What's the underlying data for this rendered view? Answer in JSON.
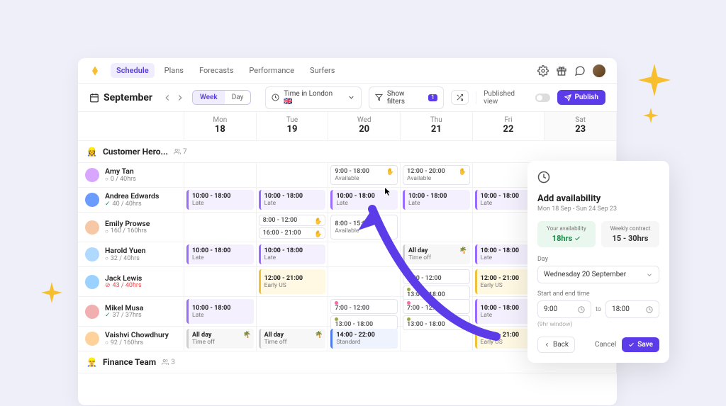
{
  "nav": {
    "tabs": [
      "Schedule",
      "Plans",
      "Forecasts",
      "Performance",
      "Surfers"
    ],
    "active": 0
  },
  "toolbar": {
    "month": "September",
    "seg": {
      "week": "Week",
      "day": "Day"
    },
    "tz": "Time in London 🇬🇧",
    "filters": "Show filters",
    "filter_count": "1",
    "pubview": "Published view",
    "publish": "Publish"
  },
  "days": [
    {
      "dow": "Mon",
      "num": "18"
    },
    {
      "dow": "Tue",
      "num": "19"
    },
    {
      "dow": "Wed",
      "num": "20"
    },
    {
      "dow": "Thu",
      "num": "21"
    },
    {
      "dow": "Fri",
      "num": "22"
    },
    {
      "dow": "Sat",
      "num": "23"
    }
  ],
  "group1": {
    "name": "Customer Hero...",
    "count": "7",
    "emoji": "👷‍♀️"
  },
  "people": [
    {
      "name": "Amy Tan",
      "stat": "0 / 40hrs",
      "dot": "○",
      "avatar": "#D9A6FF"
    },
    {
      "name": "Andrea Edwards",
      "stat": "40 / 40hrs",
      "check": "✓",
      "avatar": "#6A9BFF",
      "checkcolor": "#1F8A4C"
    },
    {
      "name": "Emily Prowse",
      "stat": "160 / 160hrs",
      "dot": "○",
      "avatar": "#F7C8A6"
    },
    {
      "name": "Harold Yuen",
      "stat": "32 / 40hrs",
      "dot": "○",
      "avatar": "#B0D9FF",
      "dotcolor": "#1F8A4C"
    },
    {
      "name": "Jack Lewis",
      "stat": "43 / 40hrs",
      "alert": "⊘",
      "avatar": "#9BD1FF"
    },
    {
      "name": "Mikel Musa",
      "stat": "37 / 37hrs",
      "check": "✓",
      "avatar": "#F2AFAF",
      "checkcolor": "#1F8A4C"
    },
    {
      "name": "Vaishvi Chowdhury",
      "stat": "92 / 160hrs",
      "dot": "○",
      "avatar": "#FFD29B"
    }
  ],
  "group2": {
    "name": "Finance Team",
    "count": "3",
    "emoji": "👷‍♂️"
  },
  "shifts": {
    "amy": [
      null,
      null,
      {
        "t": "9:00 - 18:00",
        "l": "Available",
        "cls": "s-avail",
        "emoji": "✋"
      },
      {
        "t": "12:00 - 20:00",
        "l": "Available",
        "cls": "s-avail",
        "emoji": "✋"
      },
      null,
      null
    ],
    "andrea": [
      {
        "t": "10:00 - 18:00",
        "l": "Late",
        "cls": "s-late"
      },
      {
        "t": "10:00 - 18:00",
        "l": "Late",
        "cls": "s-late"
      },
      {
        "t": "10:00 - 18:00",
        "l": "Late",
        "cls": "s-late"
      },
      {
        "t": "10:00 - 18:00",
        "l": "Late",
        "cls": "s-late"
      },
      {
        "t": "10:00 - 18:00",
        "l": "Late",
        "cls": "s-late"
      },
      null
    ],
    "emily": [
      null,
      [
        {
          "t": "8:00 - 12:00",
          "cls": "s-avail",
          "emoji": "✋"
        },
        {
          "t": "16:00 - 21:00",
          "cls": "s-avail",
          "emoji": "✋"
        }
      ],
      {
        "t": "8:00 - 15:00",
        "l": "Available",
        "cls": "s-avail"
      },
      null,
      null,
      null
    ],
    "harold": [
      {
        "t": "10:00 - 18:00",
        "l": "Late",
        "cls": "s-late"
      },
      {
        "t": "10:00 - 18:00",
        "l": "Late",
        "cls": "s-late"
      },
      null,
      {
        "t": "All day",
        "l": "Time off",
        "cls": "s-off",
        "emoji": "🌴"
      },
      {
        "t": "10:00 - 18:00",
        "l": "Late",
        "cls": "s-late"
      },
      null
    ],
    "jack": [
      null,
      {
        "t": "12:00 - 21:00",
        "l": "Early US",
        "cls": "s-early"
      },
      null,
      [
        {
          "t": "7:00 - 12:00",
          "cls": "s-avail",
          "d": "md-pink"
        },
        {
          "t": "13:00 - 18:00",
          "cls": "s-avail",
          "d": "md-olive"
        }
      ],
      {
        "t": "12:00 - 21:00",
        "l": "Early US",
        "cls": "s-early"
      },
      null
    ],
    "mikel": [
      {
        "t": "10:00 - 18:00",
        "l": "Late",
        "cls": "s-late"
      },
      null,
      [
        {
          "t": "7:00 - 12:00",
          "cls": "s-avail",
          "d": "md-pink"
        },
        {
          "t": "13:00 - 18:00",
          "cls": "s-avail",
          "d": "md-olive"
        }
      ],
      [
        {
          "t": "7:00 - 12:00",
          "cls": "s-avail",
          "d": "md-pink"
        },
        {
          "t": "13:00 - 18:00",
          "cls": "s-avail",
          "d": "md-olive"
        }
      ],
      {
        "t": "10:00 - 18:00",
        "l": "Late",
        "cls": "s-late"
      },
      null
    ],
    "vaishvi": [
      {
        "t": "All day",
        "l": "Time off",
        "cls": "s-off",
        "emoji": "🌴"
      },
      {
        "t": "All day",
        "l": "Time off",
        "cls": "s-off",
        "emoji": "🌴"
      },
      {
        "t": "14:00 - 22:00",
        "l": "Standard",
        "cls": "s-std"
      },
      null,
      {
        "t": "12:00 - 21:00",
        "l": "Early US",
        "cls": "s-early"
      },
      null
    ]
  },
  "card": {
    "title": "Add availability",
    "range": "Mon 18 Sep - Sun 24 Sep 23",
    "stat1_label": "Your availability",
    "stat1_val": "18hrs",
    "stat2_label": "Weekly contract",
    "stat2_val": "15 - 30hrs",
    "day_label": "Day",
    "day_val": "Wednesday 20 September",
    "time_label": "Start and end time",
    "start": "9:00",
    "to": "to",
    "end": "18:00",
    "hint": "(9hr window)",
    "back": "Back",
    "cancel": "Cancel",
    "save": "Save"
  }
}
